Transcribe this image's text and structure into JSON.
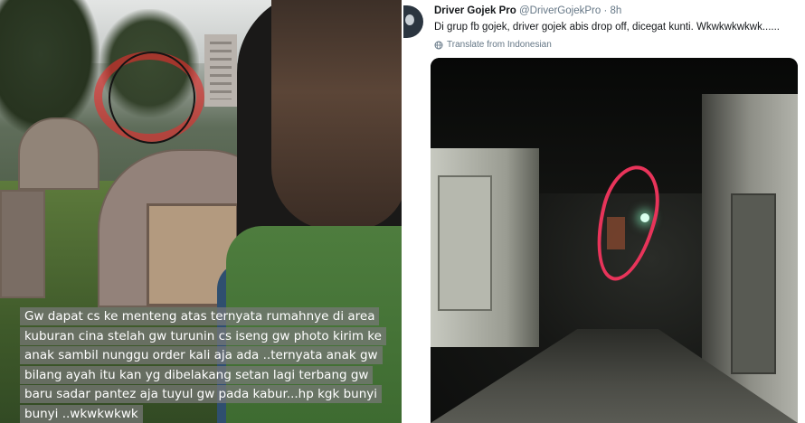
{
  "story": {
    "caption_lines": [
      "Gw dapat cs ke menteng atas ternyata rumahnye di area",
      "kuburan cina stelah gw turunin cs iseng gw photo kirim ke",
      "anak sambil nunggu order kali aja ada ..ternyata anak gw",
      "bilang ayah itu kan yg dibelakang setan lagi terbang gw",
      "baru sadar pantez aja tuyul gw pada kabur...hp kgk bunyi",
      "bunyi ..wkwkwkwk"
    ],
    "highlight_color": "#e62d2d"
  },
  "tweet": {
    "author_name": "Driver Gojek Pro",
    "author_handle": "@DriverGojekPro",
    "separator": "·",
    "time": "8h",
    "text": "Di grup fb gojek, driver gojek abis drop off, dicegat kunti. Wkwkwkwkwk......",
    "translate_label": "Translate from Indonesian",
    "photo_highlight_color": "#e8345a"
  },
  "icons": {
    "translate": "globe-icon",
    "avatar": "profile-avatar"
  }
}
